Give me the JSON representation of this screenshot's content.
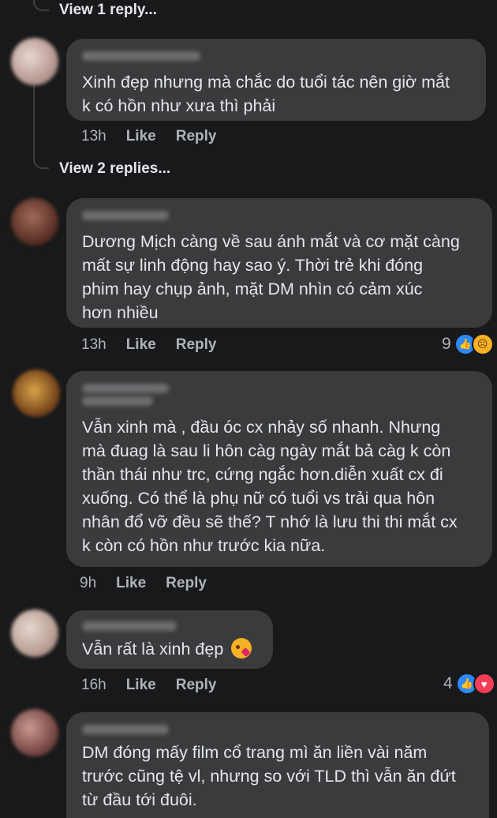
{
  "colors": {
    "background": "#18191a",
    "bubble": "#3a3b3c",
    "text": "#e4e6eb",
    "muted": "#b0b3b8",
    "like_blue": "#2d88ff"
  },
  "top_view_replies": "View 1 reply...",
  "comments": [
    {
      "text": "Xinh đẹp nhưng mà chắc do tuổi tác nên giờ mắt\nk có hồn như xưa thì phải",
      "time": "13h",
      "like": "Like",
      "reply": "Reply",
      "view_replies": "View 2 replies..."
    },
    {
      "text": "Dương Mịch càng về sau ánh mắt và cơ mặt càng\nmất sự linh động hay sao ý. Thời trẻ khi đóng\nphim hay chụp ảnh, mặt DM nhìn có cảm xúc\nhơn nhiều",
      "time": "13h",
      "like": "Like",
      "reply": "Reply",
      "reaction_count": "9",
      "reactions": [
        "like-icon",
        "sad-icon"
      ]
    },
    {
      "text": "Vẫn xinh mà , đầu óc cx nhảy số nhanh. Nhưng\nmà đuag là sau li hôn càg ngày mắt bả càg k còn\nthần thái như trc, cứng ngắc hơn.diễn xuất cx đi\nxuống. Có thể là phụ nữ có tuổi vs trải qua hôn\nnhân đổ vỡ đều sẽ thế? T nhớ là lưu thi thi mắt cx\nk còn có hồn như trước kia nữa.",
      "time": "9h",
      "like": "Like",
      "reply": "Reply"
    },
    {
      "text": "Vẫn rất là xinh đẹp",
      "emoji": "kissing-face-emoji",
      "time": "16h",
      "like": "Like",
      "reply": "Reply",
      "reaction_count": "4",
      "reactions": [
        "like-icon",
        "love-icon"
      ]
    },
    {
      "text": "DM đóng mấy film cổ trang mì ăn liền vài năm\ntrước cũng tệ vl, nhưng so với TLD thì vẫn ăn đứt\ntừ đầu tới đuôi."
    }
  ]
}
